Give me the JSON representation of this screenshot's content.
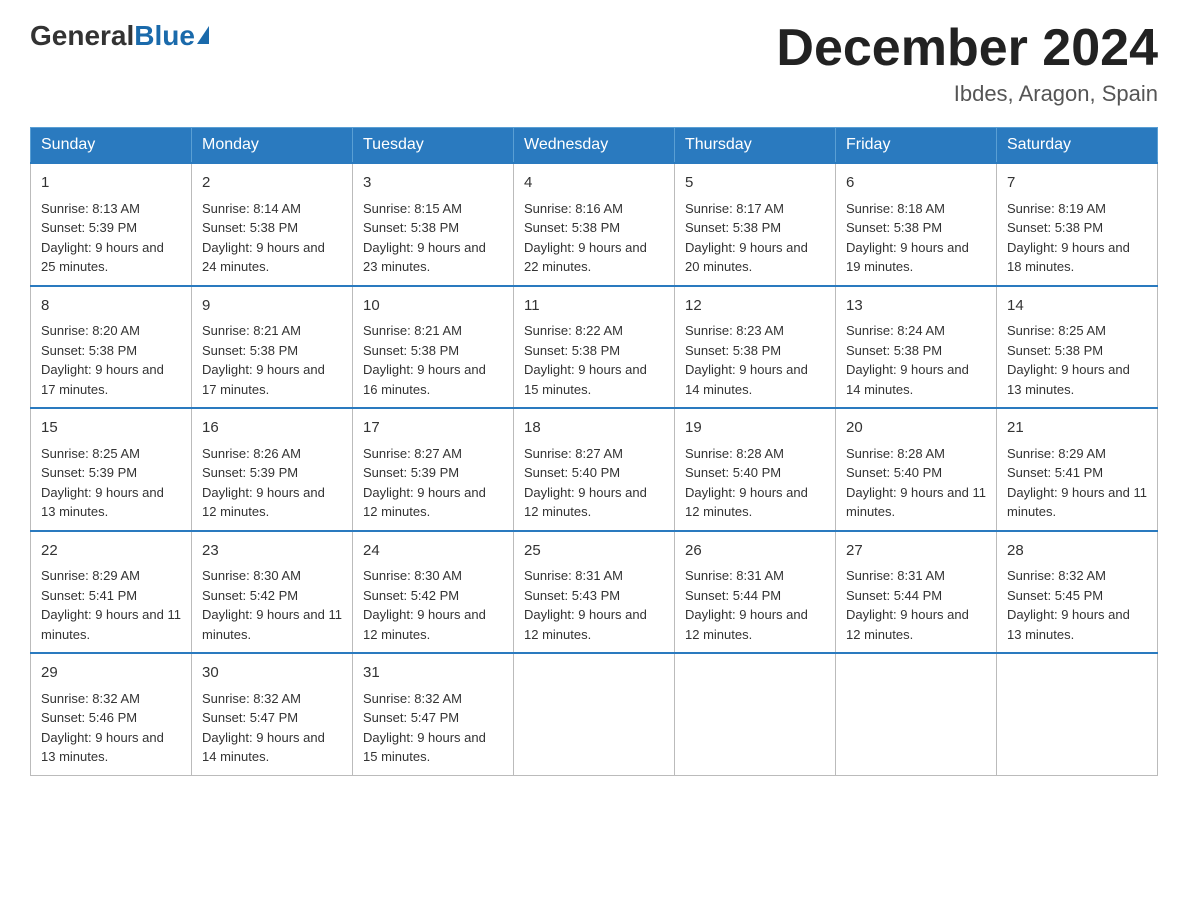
{
  "header": {
    "logo_general": "General",
    "logo_blue": "Blue",
    "month_title": "December 2024",
    "location": "Ibdes, Aragon, Spain"
  },
  "days_of_week": [
    "Sunday",
    "Monday",
    "Tuesday",
    "Wednesday",
    "Thursday",
    "Friday",
    "Saturday"
  ],
  "weeks": [
    [
      {
        "day": "1",
        "sunrise": "Sunrise: 8:13 AM",
        "sunset": "Sunset: 5:39 PM",
        "daylight": "Daylight: 9 hours and 25 minutes."
      },
      {
        "day": "2",
        "sunrise": "Sunrise: 8:14 AM",
        "sunset": "Sunset: 5:38 PM",
        "daylight": "Daylight: 9 hours and 24 minutes."
      },
      {
        "day": "3",
        "sunrise": "Sunrise: 8:15 AM",
        "sunset": "Sunset: 5:38 PM",
        "daylight": "Daylight: 9 hours and 23 minutes."
      },
      {
        "day": "4",
        "sunrise": "Sunrise: 8:16 AM",
        "sunset": "Sunset: 5:38 PM",
        "daylight": "Daylight: 9 hours and 22 minutes."
      },
      {
        "day": "5",
        "sunrise": "Sunrise: 8:17 AM",
        "sunset": "Sunset: 5:38 PM",
        "daylight": "Daylight: 9 hours and 20 minutes."
      },
      {
        "day": "6",
        "sunrise": "Sunrise: 8:18 AM",
        "sunset": "Sunset: 5:38 PM",
        "daylight": "Daylight: 9 hours and 19 minutes."
      },
      {
        "day": "7",
        "sunrise": "Sunrise: 8:19 AM",
        "sunset": "Sunset: 5:38 PM",
        "daylight": "Daylight: 9 hours and 18 minutes."
      }
    ],
    [
      {
        "day": "8",
        "sunrise": "Sunrise: 8:20 AM",
        "sunset": "Sunset: 5:38 PM",
        "daylight": "Daylight: 9 hours and 17 minutes."
      },
      {
        "day": "9",
        "sunrise": "Sunrise: 8:21 AM",
        "sunset": "Sunset: 5:38 PM",
        "daylight": "Daylight: 9 hours and 17 minutes."
      },
      {
        "day": "10",
        "sunrise": "Sunrise: 8:21 AM",
        "sunset": "Sunset: 5:38 PM",
        "daylight": "Daylight: 9 hours and 16 minutes."
      },
      {
        "day": "11",
        "sunrise": "Sunrise: 8:22 AM",
        "sunset": "Sunset: 5:38 PM",
        "daylight": "Daylight: 9 hours and 15 minutes."
      },
      {
        "day": "12",
        "sunrise": "Sunrise: 8:23 AM",
        "sunset": "Sunset: 5:38 PM",
        "daylight": "Daylight: 9 hours and 14 minutes."
      },
      {
        "day": "13",
        "sunrise": "Sunrise: 8:24 AM",
        "sunset": "Sunset: 5:38 PM",
        "daylight": "Daylight: 9 hours and 14 minutes."
      },
      {
        "day": "14",
        "sunrise": "Sunrise: 8:25 AM",
        "sunset": "Sunset: 5:38 PM",
        "daylight": "Daylight: 9 hours and 13 minutes."
      }
    ],
    [
      {
        "day": "15",
        "sunrise": "Sunrise: 8:25 AM",
        "sunset": "Sunset: 5:39 PM",
        "daylight": "Daylight: 9 hours and 13 minutes."
      },
      {
        "day": "16",
        "sunrise": "Sunrise: 8:26 AM",
        "sunset": "Sunset: 5:39 PM",
        "daylight": "Daylight: 9 hours and 12 minutes."
      },
      {
        "day": "17",
        "sunrise": "Sunrise: 8:27 AM",
        "sunset": "Sunset: 5:39 PM",
        "daylight": "Daylight: 9 hours and 12 minutes."
      },
      {
        "day": "18",
        "sunrise": "Sunrise: 8:27 AM",
        "sunset": "Sunset: 5:40 PM",
        "daylight": "Daylight: 9 hours and 12 minutes."
      },
      {
        "day": "19",
        "sunrise": "Sunrise: 8:28 AM",
        "sunset": "Sunset: 5:40 PM",
        "daylight": "Daylight: 9 hours and 12 minutes."
      },
      {
        "day": "20",
        "sunrise": "Sunrise: 8:28 AM",
        "sunset": "Sunset: 5:40 PM",
        "daylight": "Daylight: 9 hours and 11 minutes."
      },
      {
        "day": "21",
        "sunrise": "Sunrise: 8:29 AM",
        "sunset": "Sunset: 5:41 PM",
        "daylight": "Daylight: 9 hours and 11 minutes."
      }
    ],
    [
      {
        "day": "22",
        "sunrise": "Sunrise: 8:29 AM",
        "sunset": "Sunset: 5:41 PM",
        "daylight": "Daylight: 9 hours and 11 minutes."
      },
      {
        "day": "23",
        "sunrise": "Sunrise: 8:30 AM",
        "sunset": "Sunset: 5:42 PM",
        "daylight": "Daylight: 9 hours and 11 minutes."
      },
      {
        "day": "24",
        "sunrise": "Sunrise: 8:30 AM",
        "sunset": "Sunset: 5:42 PM",
        "daylight": "Daylight: 9 hours and 12 minutes."
      },
      {
        "day": "25",
        "sunrise": "Sunrise: 8:31 AM",
        "sunset": "Sunset: 5:43 PM",
        "daylight": "Daylight: 9 hours and 12 minutes."
      },
      {
        "day": "26",
        "sunrise": "Sunrise: 8:31 AM",
        "sunset": "Sunset: 5:44 PM",
        "daylight": "Daylight: 9 hours and 12 minutes."
      },
      {
        "day": "27",
        "sunrise": "Sunrise: 8:31 AM",
        "sunset": "Sunset: 5:44 PM",
        "daylight": "Daylight: 9 hours and 12 minutes."
      },
      {
        "day": "28",
        "sunrise": "Sunrise: 8:32 AM",
        "sunset": "Sunset: 5:45 PM",
        "daylight": "Daylight: 9 hours and 13 minutes."
      }
    ],
    [
      {
        "day": "29",
        "sunrise": "Sunrise: 8:32 AM",
        "sunset": "Sunset: 5:46 PM",
        "daylight": "Daylight: 9 hours and 13 minutes."
      },
      {
        "day": "30",
        "sunrise": "Sunrise: 8:32 AM",
        "sunset": "Sunset: 5:47 PM",
        "daylight": "Daylight: 9 hours and 14 minutes."
      },
      {
        "day": "31",
        "sunrise": "Sunrise: 8:32 AM",
        "sunset": "Sunset: 5:47 PM",
        "daylight": "Daylight: 9 hours and 15 minutes."
      },
      null,
      null,
      null,
      null
    ]
  ]
}
